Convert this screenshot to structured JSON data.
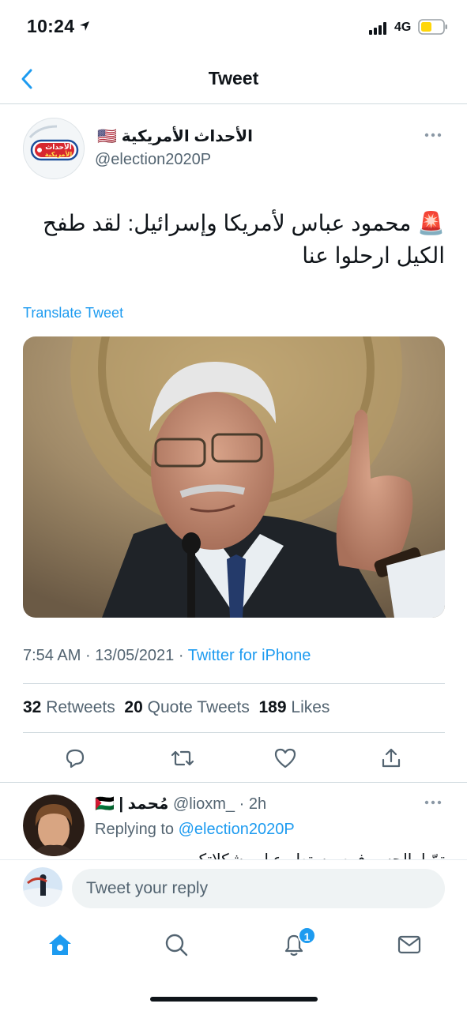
{
  "status_bar": {
    "time": "10:24",
    "network": "4G"
  },
  "nav": {
    "title": "Tweet"
  },
  "tweet": {
    "author_name": "الأحداث الأمريكية",
    "author_flag": "🇺🇸",
    "handle": "@election2020P",
    "avatar_text_line1": "الأحداث",
    "avatar_text_line2": "الأمريكية",
    "alert_emoji": "🚨",
    "text": "محمود عباس لأمريكا وإسرائيل: لقد طفح الكيل ارحلوا عنا",
    "translate": "Translate Tweet",
    "time": "7:54 AM",
    "date": "13/05/2021",
    "source": "Twitter for iPhone",
    "separator": "·",
    "stats": {
      "retweets_count": "32",
      "retweets_label": "Retweets",
      "quotes_count": "20",
      "quotes_label": "Quote Tweets",
      "likes_count": "189",
      "likes_label": "Likes"
    }
  },
  "reply": {
    "name": "مُحمد |",
    "flag": "🇵🇸",
    "handle": "@lioxm_",
    "age": "· 2h",
    "replying_prefix": "Replying to",
    "replying_handle": "@election2020P",
    "text_clipped": "تمّ ا بالحسر فمه مستطر ع ل مشكلاتكم"
  },
  "composer": {
    "placeholder": "Tweet your reply"
  },
  "tab_bar": {
    "notification_count": "1"
  },
  "colors": {
    "accent": "#1d9bf0",
    "text": "#0f1419",
    "muted": "#536471",
    "divider": "#cfd9de"
  }
}
